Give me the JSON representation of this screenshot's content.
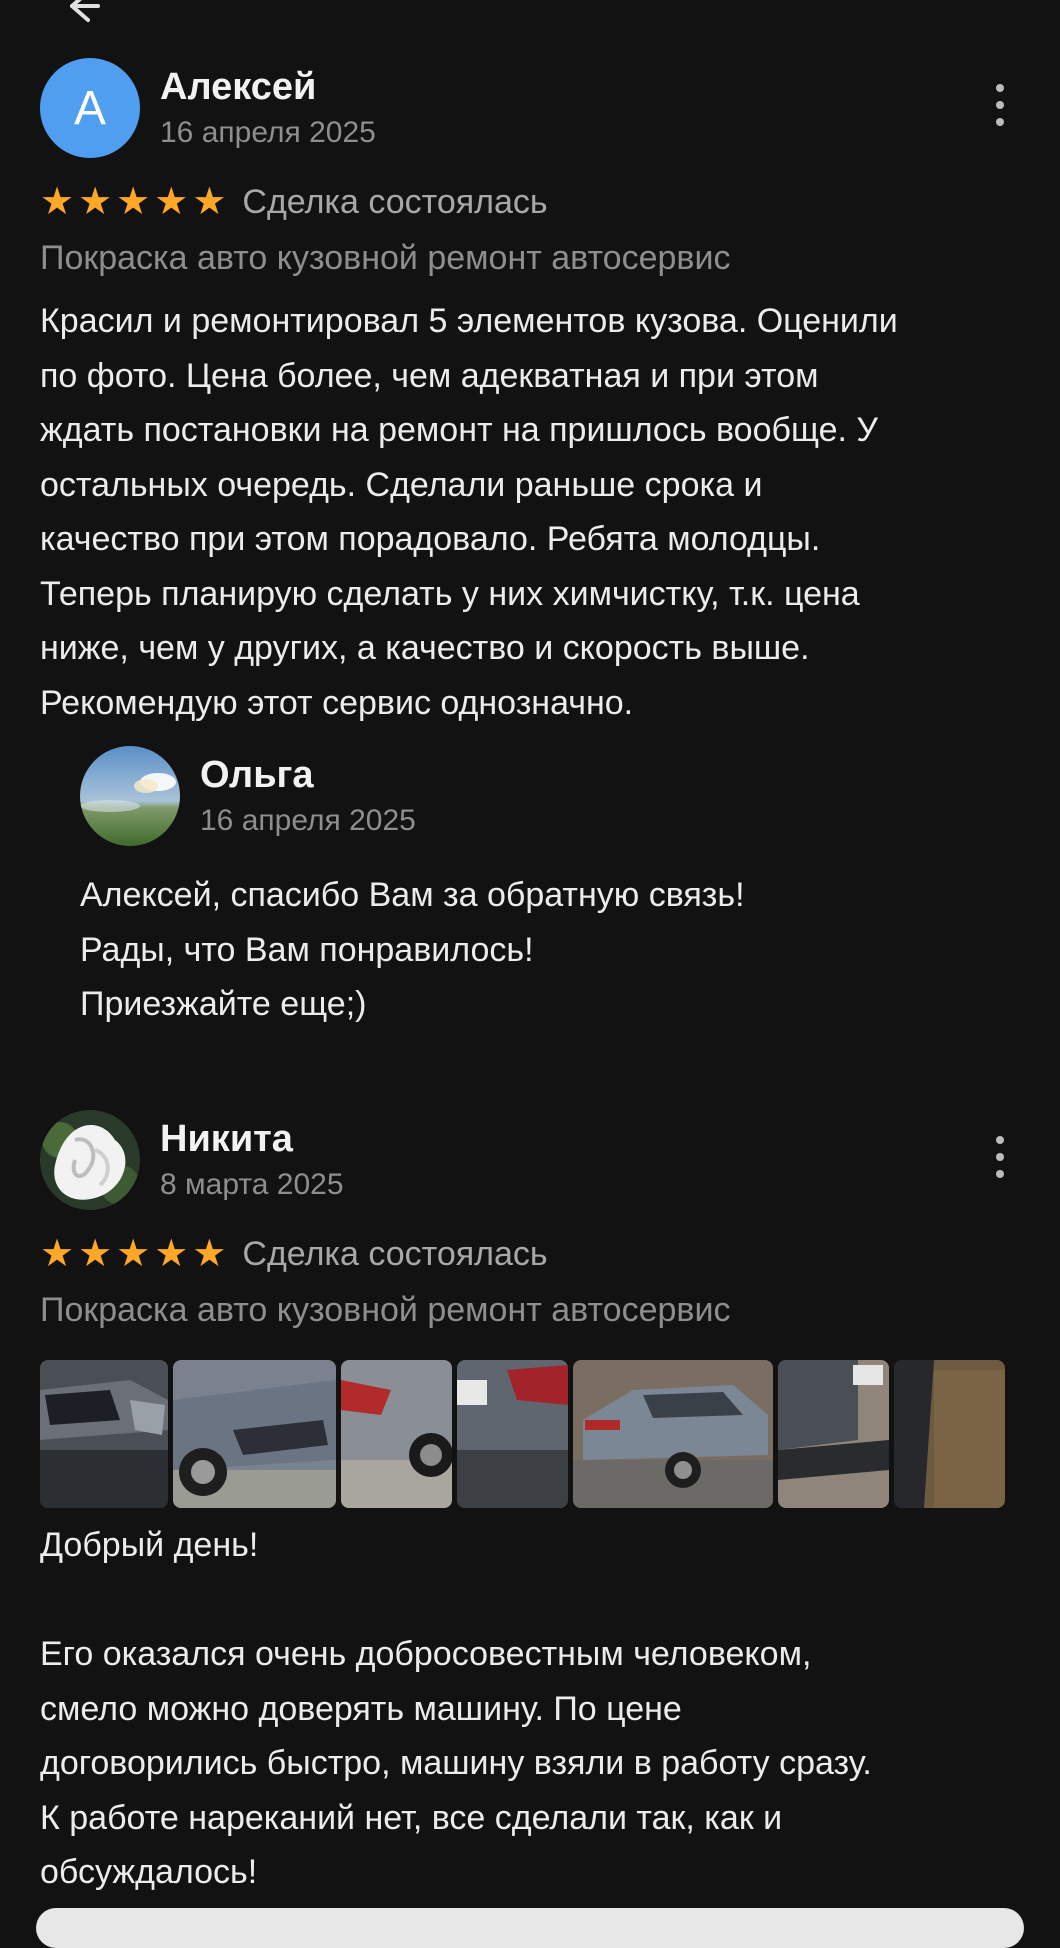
{
  "colors": {
    "background": "#121212",
    "star": "#ffa726",
    "avatar_letter_bg": "#4f9ef0",
    "muted_text": "#8e8e8e"
  },
  "reviews": [
    {
      "author": "Алексей",
      "avatar_letter": "А",
      "date": "16 апреля 2025",
      "rating": 5,
      "deal_status": "Сделка состоялась",
      "service": "Покраска авто кузовной ремонт автосервис",
      "text": "Красил и ремонтировал 5 элементов кузова. Оценили\nпо фото. Цена более, чем адекватная и при этом\nждать постановки на ремонт на пришлось вообще. У\nостальных очередь. Сделали раньше срока и\nкачество при этом порадовало. Ребята молодцы.\nТеперь планирую сделать у них химчистку, т.к. цена\nниже, чем у других, а качество и скорость выше.\nРекомендую этот сервис однозначно.",
      "reply": {
        "author": "Ольга",
        "date": "16 апреля 2025",
        "text": "Алексей, спасибо Вам за обратную связь!\nРады, что Вам понравилось!\nПриезжайте еще;)"
      }
    },
    {
      "author": "Никита",
      "date": "8 марта 2025",
      "rating": 5,
      "deal_status": "Сделка состоялась",
      "service": "Покраска авто кузовной ремонт автосервис",
      "photos_count": 8,
      "text": "Добрый день!\n\nЕго оказался очень добросовестным человеком,\nсмело можно доверять машину. По цене\nдоговорились быстро, машину взяли в работу сразу.\nК работе нареканий нет, все сделали так, как и\nобсуждалось!"
    }
  ],
  "icons": {
    "back": "arrow-left-icon",
    "more": "more-vertical-icon",
    "star": "star-icon"
  }
}
